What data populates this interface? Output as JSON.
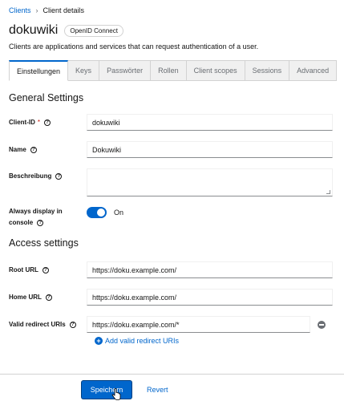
{
  "breadcrumb": {
    "link": "Clients",
    "separator": "›",
    "current": "Client details"
  },
  "header": {
    "title": "dokuwiki",
    "badge": "OpenID Connect",
    "subtitle": "Clients are applications and services that can request authentication of a user."
  },
  "tabs": [
    {
      "label": "Einstellungen",
      "active": true
    },
    {
      "label": "Keys"
    },
    {
      "label": "Passwörter"
    },
    {
      "label": "Rollen"
    },
    {
      "label": "Client scopes"
    },
    {
      "label": "Sessions"
    },
    {
      "label": "Advanced"
    }
  ],
  "general": {
    "title": "General Settings",
    "client_id_label": "Client-ID",
    "client_id_required": "*",
    "client_id_value": "dokuwiki",
    "name_label": "Name",
    "name_value": "Dokuwiki",
    "description_label": "Beschreibung",
    "description_value": "",
    "always_display_label_1": "Always display in",
    "always_display_label_2": "console",
    "always_display_state": "On"
  },
  "access": {
    "title": "Access settings",
    "root_url_label": "Root URL",
    "root_url_value": "https://doku.example.com/",
    "home_url_label": "Home URL",
    "home_url_value": "https://doku.example.com/",
    "redirect_label": "Valid redirect URIs",
    "redirect_value": "https://doku.example.com/*",
    "add_redirect": "Add valid redirect URIs"
  },
  "footer": {
    "save": "Speichern",
    "revert": "Revert"
  },
  "colors": {
    "accent": "#0066cc",
    "danger": "#c9190b",
    "text": "#151515",
    "muted": "#6a6e73"
  },
  "icons": {
    "help": "help-circle-icon",
    "remove": "minus-circle-icon",
    "add": "plus-circle-icon",
    "separator": "chevron-right-icon"
  }
}
